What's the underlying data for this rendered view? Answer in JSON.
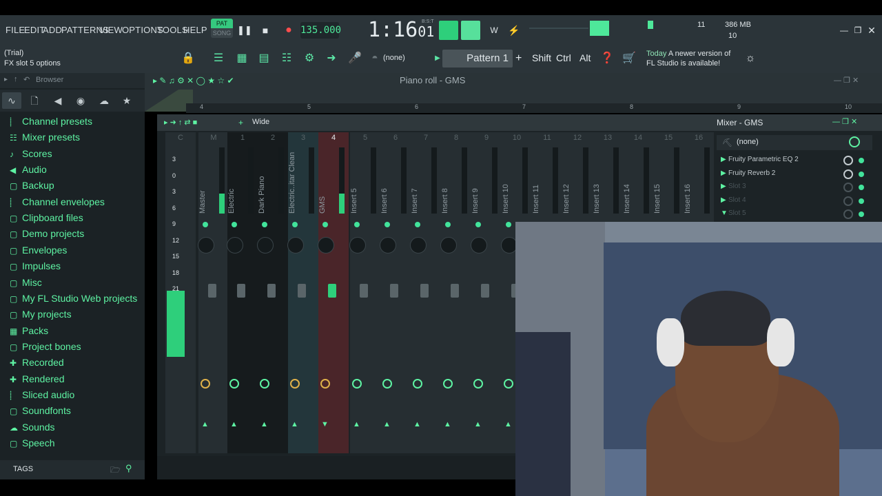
{
  "menu": [
    "FILE",
    "EDIT",
    "ADD",
    "PATTERNS",
    "VIEW",
    "OPTIONS",
    "TOOLS",
    "HELP"
  ],
  "transport": {
    "pat_label": "PAT",
    "song_label": "SONG",
    "tempo": "135.000",
    "time_main": "1:16",
    "time_sub": "01",
    "time_unit": "B:S:T"
  },
  "cpu": {
    "value": "11",
    "memory": "386 MB",
    "polyphony": "10"
  },
  "hint": {
    "line1": "(Trial)",
    "line2": "FX slot 5 options"
  },
  "toolbar": {
    "channel_select": "(none)",
    "pattern": "Pattern 1",
    "plus": "+",
    "shift": "Shift",
    "ctrl": "Ctrl",
    "alt": "Alt"
  },
  "news": {
    "today": "Today",
    "line1": "A newer version of",
    "line2": "FL Studio is available!"
  },
  "browser": {
    "title": "Browser",
    "items": [
      {
        "icon": "wave",
        "label": "Channel presets"
      },
      {
        "icon": "mixer",
        "label": "Mixer presets"
      },
      {
        "icon": "note",
        "label": "Scores"
      },
      {
        "icon": "speaker",
        "label": "Audio"
      },
      {
        "icon": "folder",
        "label": "Backup"
      },
      {
        "icon": "wave",
        "label": "Channel envelopes"
      },
      {
        "icon": "folder",
        "label": "Clipboard files"
      },
      {
        "icon": "folder",
        "label": "Demo projects"
      },
      {
        "icon": "folder",
        "label": "Envelopes"
      },
      {
        "icon": "folder",
        "label": "Impulses"
      },
      {
        "icon": "folder",
        "label": "Misc"
      },
      {
        "icon": "folder",
        "label": "My FL Studio Web projects"
      },
      {
        "icon": "folder",
        "label": "My projects"
      },
      {
        "icon": "pack",
        "label": "Packs"
      },
      {
        "icon": "folder",
        "label": "Project bones"
      },
      {
        "icon": "plus",
        "label": "Recorded"
      },
      {
        "icon": "plus",
        "label": "Rendered"
      },
      {
        "icon": "wave",
        "label": "Sliced audio"
      },
      {
        "icon": "folder",
        "label": "Soundfonts"
      },
      {
        "icon": "cloud",
        "label": "Sounds"
      },
      {
        "icon": "folder",
        "label": "Speech"
      }
    ],
    "tags_label": "TAGS"
  },
  "pianoroll": {
    "title": "Piano roll - GMS",
    "ruler": [
      "4",
      "5",
      "6",
      "7",
      "8",
      "9",
      "10"
    ]
  },
  "mixer": {
    "title": "Mixer - GMS",
    "view_mode": "Wide",
    "track_select": "(none)",
    "slots": [
      "Fruity Parametric EQ 2",
      "Fruity Reverb 2",
      "Slot 3",
      "Slot 4",
      "Slot 5"
    ],
    "db_scale": [
      "3",
      "0",
      "3",
      "6",
      "9",
      "12",
      "15",
      "18",
      "21"
    ],
    "strips": [
      {
        "num": "C",
        "name": ""
      },
      {
        "num": "M",
        "name": "Master"
      },
      {
        "num": "1",
        "name": "Electric"
      },
      {
        "num": "2",
        "name": "Dark Piano"
      },
      {
        "num": "3",
        "name": "Electric..itar Clean"
      },
      {
        "num": "4",
        "name": "GMS"
      },
      {
        "num": "5",
        "name": "Insert 5"
      },
      {
        "num": "6",
        "name": "Insert 6"
      },
      {
        "num": "7",
        "name": "Insert 7"
      },
      {
        "num": "8",
        "name": "Insert 8"
      },
      {
        "num": "9",
        "name": "Insert 9"
      },
      {
        "num": "10",
        "name": "Insert 10"
      },
      {
        "num": "11",
        "name": "Insert 11"
      },
      {
        "num": "12",
        "name": "Insert 12"
      },
      {
        "num": "13",
        "name": "Insert 13"
      },
      {
        "num": "14",
        "name": "Insert 14"
      },
      {
        "num": "15",
        "name": "Insert 15"
      },
      {
        "num": "16",
        "name": "Insert 16"
      }
    ]
  },
  "colors": {
    "accent": "#42e39b",
    "panel": "#2b3439",
    "dark": "#1c2326",
    "selected_strip": "#5a2a2a"
  }
}
